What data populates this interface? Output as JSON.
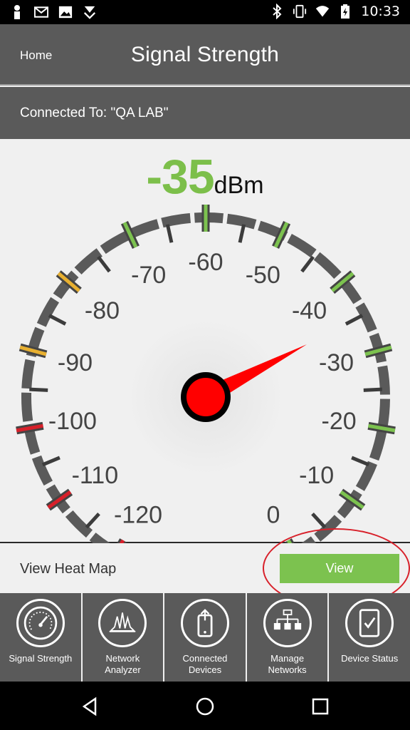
{
  "status_bar": {
    "time": "10:33",
    "left_icons": [
      "person-icon",
      "gmail-icon",
      "image-icon",
      "app-icon"
    ],
    "right_icons": [
      "bluetooth-icon",
      "vibrate-icon",
      "wifi-icon",
      "battery-charging-icon"
    ]
  },
  "header": {
    "home_label": "Home",
    "title": "Signal Strength"
  },
  "connection": {
    "text": "Connected To: \"QA LAB\""
  },
  "reading": {
    "value": "-35",
    "unit": "dBm",
    "value_color": "#7cbf4a",
    "needle_value": -35
  },
  "gauge": {
    "min": -120,
    "max": 0,
    "labels": [
      "-120",
      "-110",
      "-100",
      "-90",
      "-80",
      "-70",
      "-60",
      "-50",
      "-40",
      "-30",
      "-20",
      "-10",
      "0"
    ],
    "zone_colors": {
      "red": "#d8202a",
      "yellow": "#e8b030",
      "green": "#7cc24f",
      "track": "#5a5a5a"
    }
  },
  "heatmap": {
    "label": "View Heat Map",
    "button_label": "View",
    "button_color": "#7cc24f"
  },
  "bottom_nav": [
    {
      "label": "Signal Strength",
      "icon": "speedometer-icon"
    },
    {
      "label": "Network Analyzer",
      "icon": "spectrum-icon"
    },
    {
      "label": "Connected Devices",
      "icon": "device-upload-icon"
    },
    {
      "label": "Manage Networks",
      "icon": "network-tree-icon"
    },
    {
      "label": "Device Status",
      "icon": "phone-check-icon"
    }
  ],
  "system_nav": {
    "buttons": [
      "back-icon",
      "home-icon",
      "recents-icon"
    ]
  }
}
